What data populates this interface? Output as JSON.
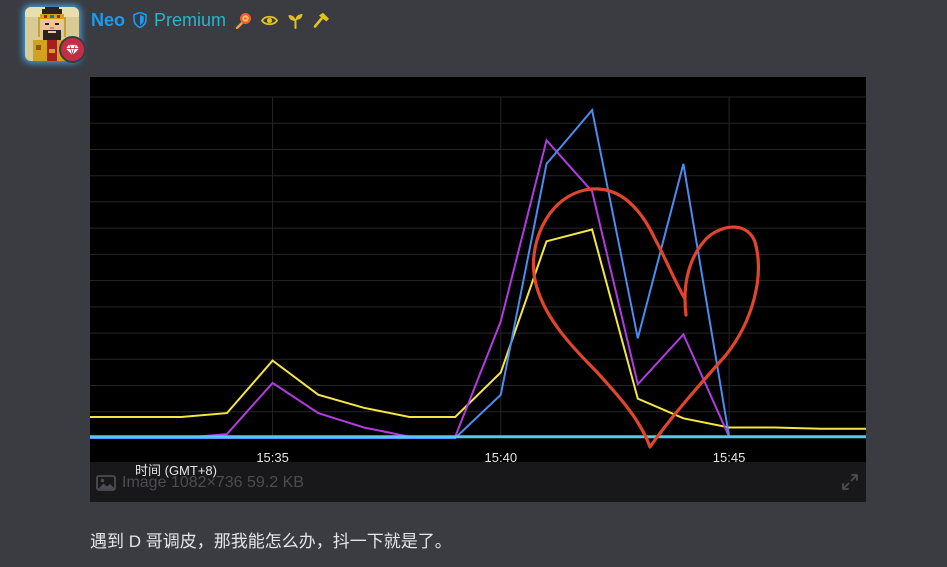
{
  "author": {
    "name": "Neo",
    "premium_label": "Premium",
    "avatar_icon": "pixel-emperor-avatar-icon",
    "avatar_badge_icon": "diamond-badge-icon",
    "badges": [
      "lollipop-icon",
      "eye-icon",
      "sprout-icon",
      "hammer-icon"
    ],
    "colors": {
      "name": "#1d9bf0",
      "premium": "#26b6c9",
      "badge_bg": "#c22f45"
    }
  },
  "image": {
    "meta_label": "Image 1082×736 59.2 KB",
    "expand_icon": "expand-icon",
    "image_icon": "image-icon"
  },
  "chart_data": {
    "type": "line",
    "xlabel": "时间 (GMT+8)",
    "ylabel": "",
    "x_ticks": [
      "15:35",
      "15:40",
      "15:45"
    ],
    "x": [
      "15:31",
      "15:32",
      "15:33",
      "15:34",
      "15:35",
      "15:36",
      "15:37",
      "15:38",
      "15:39",
      "15:40",
      "15:41",
      "15:42",
      "15:43",
      "15:44",
      "15:45",
      "15:46",
      "15:47",
      "15:48"
    ],
    "ylim": [
      0,
      13
    ],
    "grid": true,
    "series": [
      {
        "color": "#f5e642",
        "values": [
          0.8,
          0.8,
          0.8,
          0.95,
          2.95,
          1.65,
          1.15,
          0.8,
          0.8,
          2.5,
          7.5,
          7.95,
          1.5,
          0.75,
          0.4,
          0.4,
          0.35,
          0.35
        ]
      },
      {
        "color": "#b03be0",
        "values": [
          0,
          0,
          0,
          0.15,
          2.1,
          0.95,
          0.4,
          0.05,
          0.05,
          4.45,
          11.35,
          9.4,
          2.05,
          3.95,
          0.05,
          0.05,
          0.05,
          0.05
        ]
      },
      {
        "color": "#4a8cf0",
        "values": [
          0,
          0,
          0,
          0,
          0,
          0,
          0,
          0,
          0,
          1.65,
          10.45,
          12.5,
          3.8,
          10.45,
          0.05,
          0.05,
          0.05,
          0.05
        ]
      },
      {
        "color": "#55c8ee",
        "values": [
          0.05,
          0.05,
          0.05,
          0.05,
          0.05,
          0.05,
          0.05,
          0.05,
          0.05,
          0.05,
          0.05,
          0.05,
          0.05,
          0.05,
          0.05,
          0.05,
          0.05,
          0.05
        ]
      }
    ],
    "annotation": {
      "shape": "heart",
      "color": "#e0452d"
    }
  },
  "post": {
    "text": "遇到 D 哥调皮，那我能怎么办，抖一下就是了。"
  }
}
